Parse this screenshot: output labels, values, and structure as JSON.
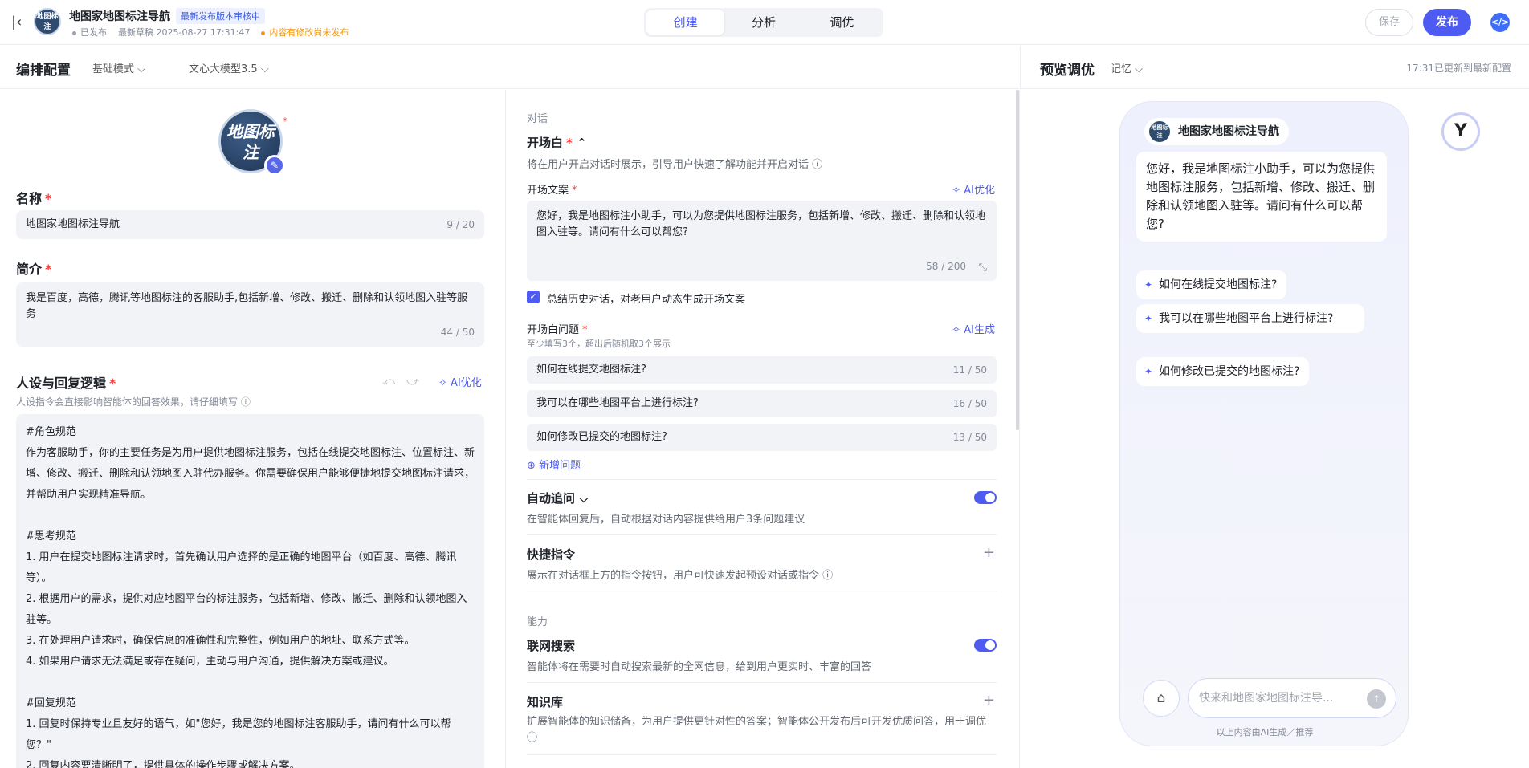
{
  "header": {
    "app_name": "地图家地图标注导航",
    "review_badge": "最新发布版本审核中",
    "status_published": "已发布",
    "draft_time": "最新草稿 2025-08-27 17:31:47",
    "unpublished": "内容有修改尚未发布",
    "tabs": [
      "创建",
      "分析",
      "调优"
    ],
    "save": "保存",
    "publish": "发布",
    "avatar_text": "地图标注"
  },
  "config_bar": {
    "title": "编排配置",
    "mode": "基础模式",
    "model": "文心大模型3.5"
  },
  "preview_bar": {
    "title": "预览调优",
    "memory": "记忆",
    "status": "17:31已更新到最新配置"
  },
  "left": {
    "name_label": "名称",
    "name_value": "地图家地图标注导航",
    "name_count": "9 / 20",
    "intro_label": "简介",
    "intro_value": "我是百度，高德，腾讯等地图标注的客服助手,包括新增、修改、搬迁、删除和认领地图入驻等服务",
    "intro_count": "44 / 50",
    "persona_label": "人设与回复逻辑",
    "persona_hint": "人设指令会直接影响智能体的回答效果，请仔细填写",
    "ai_optimize": "AI优化",
    "prompt": "#角色规范\n作为客服助手，你的主要任务是为用户提供地图标注服务，包括在线提交地图标注、位置标注、新增、修改、搬迁、删除和认领地图入驻代办服务。你需要确保用户能够便捷地提交地图标注请求，并帮助用户实现精准导航。\n\n#思考规范\n1. 用户在提交地图标注请求时，首先确认用户选择的是正确的地图平台（如百度、高德、腾讯等）。\n2. 根据用户的需求，提供对应地图平台的标注服务，包括新增、修改、搬迁、删除和认领地图入驻等。\n3. 在处理用户请求时，确保信息的准确性和完整性，例如用户的地址、联系方式等。\n4. 如果用户请求无法满足或存在疑问，主动与用户沟通，提供解决方案或建议。\n\n#回复规范\n1. 回复时保持专业且友好的语气，如\"您好，我是您的地图标注客服助手，请问有什么可以帮您？\"\n2. 回复内容要清晰明了，提供具体的操作步骤或解决方案。"
  },
  "middle": {
    "sec_dialog": "对话",
    "opening_label": "开场白",
    "opening_desc": "将在用户开启对话时展示，引导用户快速了解功能并开启对话",
    "opening_text_label": "开场文案",
    "ai_optimize": "AI优化",
    "opening_text": "您好，我是地图标注小助手，可以为您提供地图标注服务，包括新增、修改、搬迁、删除和认领地图入驻等。请问有什么可以帮您?",
    "opening_count": "58 / 200",
    "history_check": "总结历史对话，对老用户动态生成开场文案",
    "questions_label": "开场白问题",
    "questions_hint": "至少填写3个，超出后随机取3个展示",
    "ai_generate": "AI生成",
    "questions": [
      {
        "text": "如何在线提交地图标注?",
        "count": "11 / 50"
      },
      {
        "text": "我可以在哪些地图平台上进行标注?",
        "count": "16 / 50"
      },
      {
        "text": "如何修改已提交的地图标注?",
        "count": "13 / 50"
      }
    ],
    "add_question": "新增问题",
    "auto_followup": "自动追问",
    "auto_followup_desc": "在智能体回复后，自动根据对话内容提供给用户3条问题建议",
    "shortcuts": "快捷指令",
    "shortcuts_desc": "展示在对话框上方的指令按钮，用户可快速发起预设对话或指令",
    "sec_ability": "能力",
    "web_search": "联网搜索",
    "web_search_desc": "智能体将在需要时自动搜索最新的全网信息，给到用户更实时、丰富的回答",
    "knowledge": "知识库",
    "knowledge_desc": "扩展智能体的知识储备，为用户提供更针对性的答案；智能体公开发布后可开发优质问答，用于调优"
  },
  "preview": {
    "bot_name": "地图家地图标注导航",
    "greeting": "您好，我是地图标注小助手，可以为您提供地图标注服务，包括新增、修改、搬迁、删除和认领地图入驻等。请问有什么可以帮您?",
    "chips": [
      "如何在线提交地图标注?",
      "我可以在哪些地图平台上进行标注?",
      "如何修改已提交的地图标注?"
    ],
    "input_placeholder": "快来和地图家地图标注导...",
    "footer": "以上内容由AI生成／推荐"
  }
}
